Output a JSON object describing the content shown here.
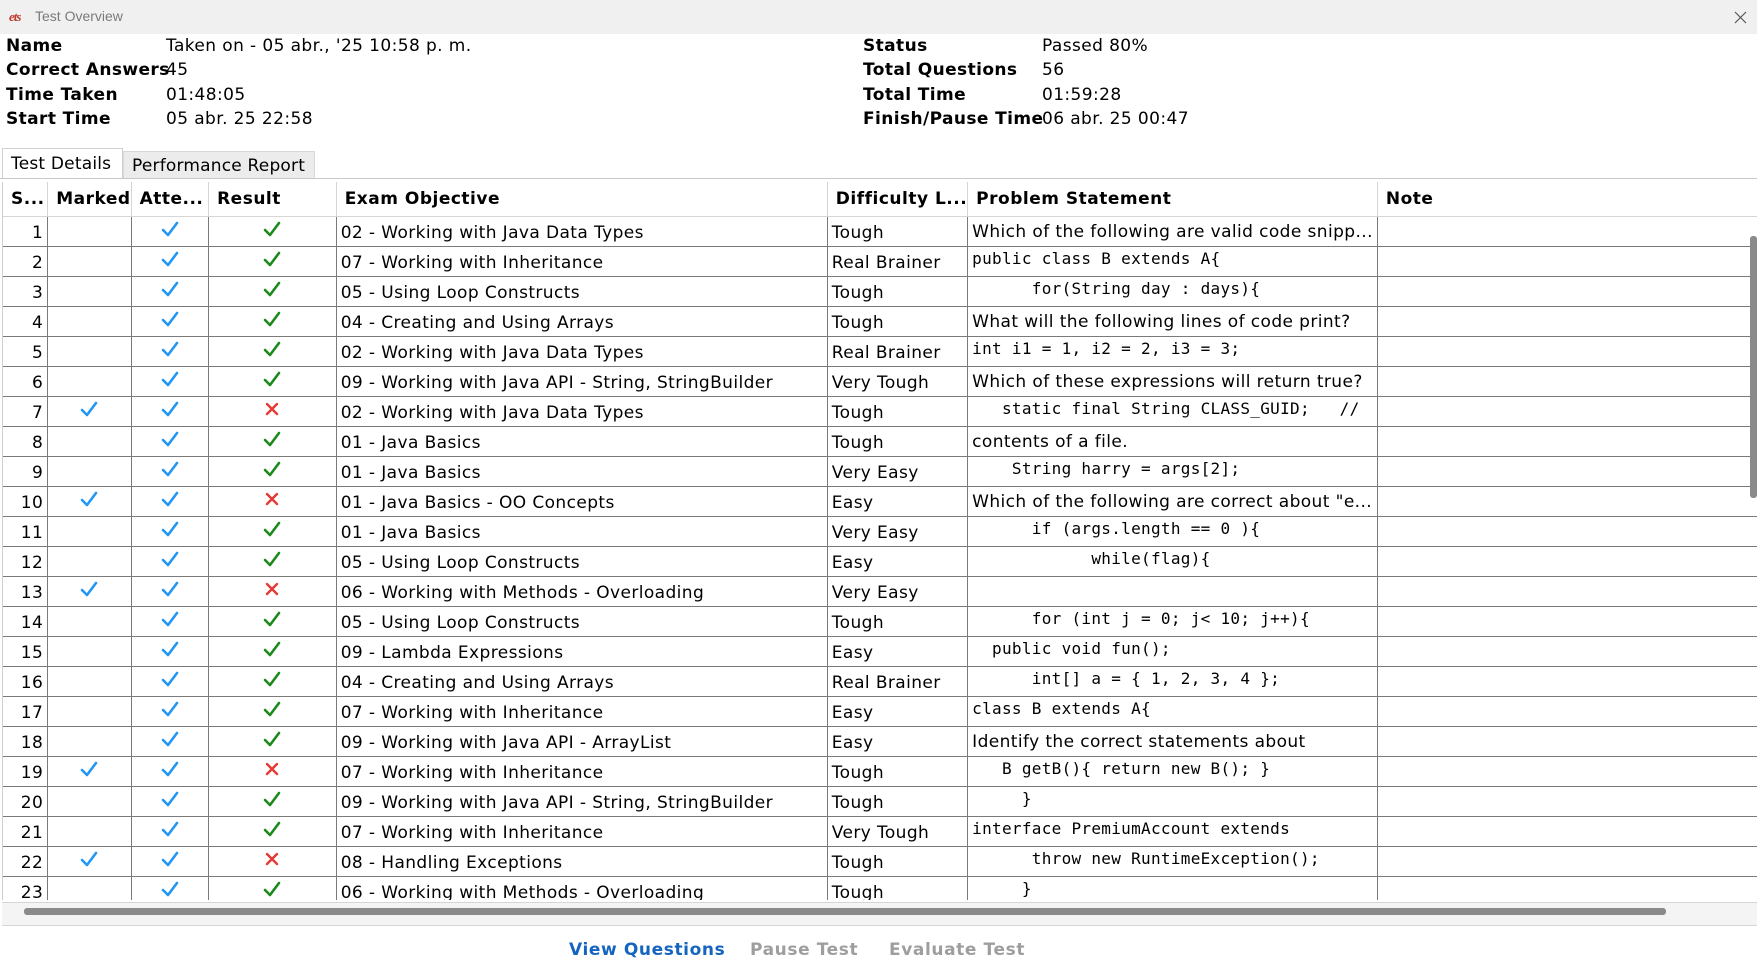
{
  "window": {
    "title": "Test Overview",
    "app_icon": "ets-logo-icon"
  },
  "summary": {
    "left": [
      {
        "label": "Name",
        "value": "Taken on - 05 abr., '25 10:58 p. m."
      },
      {
        "label": "Correct Answers",
        "value": "45"
      },
      {
        "label": "Time Taken",
        "value": "01:48:05"
      },
      {
        "label": "Start Time",
        "value": "05 abr. 25 22:58"
      }
    ],
    "right": [
      {
        "label": "Status",
        "value": "Passed 80%"
      },
      {
        "label": "Total Questions",
        "value": "56"
      },
      {
        "label": "Total Time",
        "value": "01:59:28"
      },
      {
        "label": "Finish/Pause Time",
        "value": "06 abr. 25 00:47"
      }
    ]
  },
  "tabs": [
    {
      "label": "Test Details",
      "active": true
    },
    {
      "label": "Performance Report",
      "active": false
    }
  ],
  "table": {
    "columns": [
      "S...",
      "Marked",
      "Atte...",
      "Result",
      "Exam Objective",
      "Difficulty L...",
      "Problem Statement",
      "Note"
    ],
    "rows": [
      {
        "sno": "1",
        "marked": false,
        "attempted": true,
        "correct": true,
        "objective": "02 - Working with Java Data Types",
        "difficulty": "Tough",
        "problem": "Which of the following are valid code snipp...",
        "mono": false
      },
      {
        "sno": "2",
        "marked": false,
        "attempted": true,
        "correct": true,
        "objective": "07 - Working with Inheritance",
        "difficulty": "Real Brainer",
        "problem": "public class B extends A{",
        "mono": true
      },
      {
        "sno": "3",
        "marked": false,
        "attempted": true,
        "correct": true,
        "objective": "05 - Using Loop Constructs",
        "difficulty": "Tough",
        "problem": "      for(String day : days){",
        "mono": true
      },
      {
        "sno": "4",
        "marked": false,
        "attempted": true,
        "correct": true,
        "objective": "04 - Creating and Using Arrays",
        "difficulty": "Tough",
        "problem": "What will the following lines of code print?",
        "mono": false
      },
      {
        "sno": "5",
        "marked": false,
        "attempted": true,
        "correct": true,
        "objective": "02 - Working with Java Data Types",
        "difficulty": "Real Brainer",
        "problem": "int i1 = 1, i2 = 2, i3 = 3;",
        "mono": true
      },
      {
        "sno": "6",
        "marked": false,
        "attempted": true,
        "correct": true,
        "objective": "09 - Working with Java API - String, StringBuilder",
        "difficulty": "Very Tough",
        "problem": "Which of these expressions will return true?",
        "mono": false
      },
      {
        "sno": "7",
        "marked": true,
        "attempted": true,
        "correct": false,
        "objective": "02 - Working with Java Data Types",
        "difficulty": "Tough",
        "problem": "   static final String CLASS_GUID;   //",
        "mono": true
      },
      {
        "sno": "8",
        "marked": false,
        "attempted": true,
        "correct": true,
        "objective": "01 - Java Basics",
        "difficulty": "Tough",
        "problem": "contents of a file.",
        "mono": false
      },
      {
        "sno": "9",
        "marked": false,
        "attempted": true,
        "correct": true,
        "objective": "01 - Java Basics",
        "difficulty": "Very Easy",
        "problem": "    String harry = args[2];",
        "mono": true
      },
      {
        "sno": "10",
        "marked": true,
        "attempted": true,
        "correct": false,
        "objective": "01 - Java Basics - OO Concepts",
        "difficulty": "Easy",
        "problem": "Which of the following are correct about \"e...",
        "mono": false
      },
      {
        "sno": "11",
        "marked": false,
        "attempted": true,
        "correct": true,
        "objective": "01 - Java Basics",
        "difficulty": "Very Easy",
        "problem": "      if (args.length == 0 ){",
        "mono": true
      },
      {
        "sno": "12",
        "marked": false,
        "attempted": true,
        "correct": true,
        "objective": "05 - Using Loop Constructs",
        "difficulty": "Easy",
        "problem": "            while(flag){",
        "mono": true
      },
      {
        "sno": "13",
        "marked": true,
        "attempted": true,
        "correct": false,
        "objective": "06 - Working with Methods - Overloading",
        "difficulty": "Very Easy",
        "problem": "",
        "mono": true
      },
      {
        "sno": "14",
        "marked": false,
        "attempted": true,
        "correct": true,
        "objective": "05 - Using Loop Constructs",
        "difficulty": "Tough",
        "problem": "      for (int j = 0; j< 10; j++){",
        "mono": true
      },
      {
        "sno": "15",
        "marked": false,
        "attempted": true,
        "correct": true,
        "objective": "09 - Lambda Expressions",
        "difficulty": "Easy",
        "problem": "  public void fun();",
        "mono": true
      },
      {
        "sno": "16",
        "marked": false,
        "attempted": true,
        "correct": true,
        "objective": "04 - Creating and Using Arrays",
        "difficulty": "Real Brainer",
        "problem": "      int[] a = { 1, 2, 3, 4 };",
        "mono": true
      },
      {
        "sno": "17",
        "marked": false,
        "attempted": true,
        "correct": true,
        "objective": "07 - Working with Inheritance",
        "difficulty": "Easy",
        "problem": "class B extends A{",
        "mono": true
      },
      {
        "sno": "18",
        "marked": false,
        "attempted": true,
        "correct": true,
        "objective": "09 - Working with Java API - ArrayList",
        "difficulty": "Easy",
        "problem": "Identify the correct statements about",
        "mono": false
      },
      {
        "sno": "19",
        "marked": true,
        "attempted": true,
        "correct": false,
        "objective": "07 - Working with Inheritance",
        "difficulty": "Tough",
        "problem": "   B getB(){ return new B(); }",
        "mono": true
      },
      {
        "sno": "20",
        "marked": false,
        "attempted": true,
        "correct": true,
        "objective": "09 - Working with Java API - String, StringBuilder",
        "difficulty": "Tough",
        "problem": "     }",
        "mono": true
      },
      {
        "sno": "21",
        "marked": false,
        "attempted": true,
        "correct": true,
        "objective": "07 - Working with Inheritance",
        "difficulty": "Very Tough",
        "problem": "interface PremiumAccount extends",
        "mono": true
      },
      {
        "sno": "22",
        "marked": true,
        "attempted": true,
        "correct": false,
        "objective": "08 - Handling Exceptions",
        "difficulty": "Tough",
        "problem": "      throw new RuntimeException();",
        "mono": true
      },
      {
        "sno": "23",
        "marked": false,
        "attempted": true,
        "correct": true,
        "objective": "06 - Working with Methods - Overloading",
        "difficulty": "Tough",
        "problem": "     }",
        "mono": true
      }
    ]
  },
  "buttons": {
    "view_questions": "View Questions",
    "pause_test": "Pause Test",
    "evaluate_test": "Evaluate Test"
  },
  "colors": {
    "tick": "#2196f3",
    "correct": "#1b8a1b",
    "wrong": "#e53935",
    "primary": "#1565c0"
  }
}
